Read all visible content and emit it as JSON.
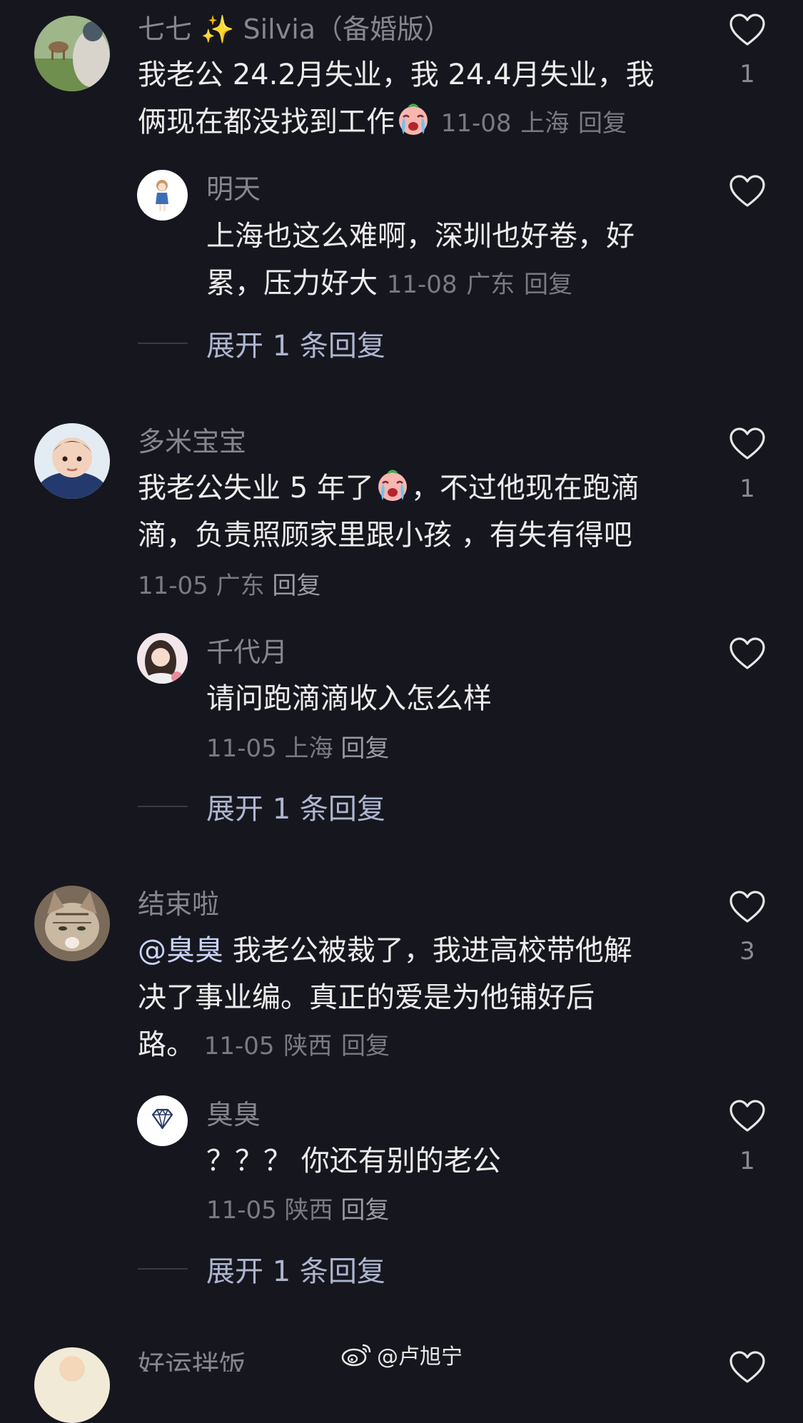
{
  "comments": [
    {
      "username": "七七 ✨ Silvia（备婚版）",
      "lines": [
        "我老公 24.2月失业，我 24.4月失业，我",
        "俩现在都没找到工作"
      ],
      "date": "11-08",
      "location": "上海",
      "reply_label": "回复",
      "likes": "1",
      "avatar_icon": "deer-photo-avatar",
      "emoji": "crying-face-emoji",
      "reply": {
        "username": "明天",
        "lines": [
          "上海也这么难啊，深圳也好卷，好",
          "累，压力好大"
        ],
        "date": "11-08",
        "location": "广东",
        "reply_label": "回复",
        "likes": "",
        "avatar_icon": "cartoon-girl-avatar"
      },
      "expand_label": "展开 1 条回复"
    },
    {
      "username": "多米宝宝",
      "lines": [
        "我老公失业 5 年了",
        "，不过他现在跑滴",
        "滴，负责照顾家里跟小孩 ，有失有得吧"
      ],
      "date": "11-05",
      "location": "广东",
      "reply_label": "回复",
      "likes": "1",
      "avatar_icon": "baby-photo-avatar",
      "emoji": "crying-face-emoji",
      "reply": {
        "username": "千代月",
        "lines": [
          "请问跑滴滴收入怎么样"
        ],
        "date": "11-05",
        "location": "上海",
        "reply_label": "回复",
        "likes": "",
        "avatar_icon": "girl-photo-avatar"
      },
      "expand_label": "展开 1 条回复"
    },
    {
      "username": "结束啦",
      "mention": "@臭臭",
      "lines": [
        " 我老公被裁了，我进高校带他解",
        "决了事业编。真正的爱是为他铺好后",
        "路。"
      ],
      "date": "11-05",
      "location": "陕西",
      "reply_label": "回复",
      "likes": "3",
      "avatar_icon": "cat-photo-avatar",
      "reply": {
        "username": "臭臭",
        "lines": [
          "？？？ 你还有别的老公"
        ],
        "date": "11-05",
        "location": "陕西",
        "reply_label": "回复",
        "likes": "1",
        "avatar_icon": "diamond-avatar"
      },
      "expand_label": "展开 1 条回复"
    },
    {
      "username": "好运拌饭",
      "avatar_icon": "partial-avatar"
    }
  ],
  "watermark": {
    "text": "@卢旭宁",
    "icon": "weibo-icon"
  },
  "colors": {
    "background": "#16161e",
    "text": "#ececec",
    "muted": "#7a7a82",
    "expand": "#aeb5cf"
  }
}
